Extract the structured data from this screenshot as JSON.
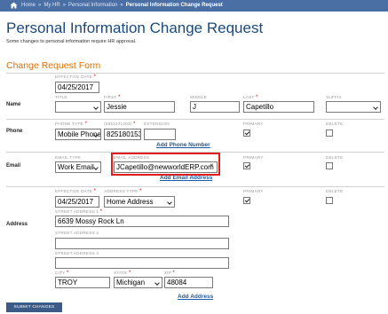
{
  "breadcrumb": {
    "items": [
      "Home",
      "My HR",
      "Personal Information"
    ],
    "separator": "»",
    "current": "Personal Information Change Request"
  },
  "page": {
    "title": "Personal Information Change Request",
    "subtitle": "Some changes to personal information require HR approval.",
    "section_title": "Change Request Form"
  },
  "name": {
    "row_label": "Name",
    "effective_date_label": "EFFECTIVE DATE",
    "effective_date": "04/25/2017",
    "title_label": "TITLE",
    "title_value": "",
    "first_label": "FIRST",
    "first_value": "Jessie",
    "middle_label": "MIDDLE",
    "middle_value": "J",
    "last_label": "LAST",
    "last_value": "Capetillo",
    "suffix_label": "SUFFIX",
    "suffix_value": ""
  },
  "phone": {
    "row_label": "Phone",
    "type_label": "PHONE TYPE",
    "type_value": "Mobile Phone",
    "number_label": "(5551231203)",
    "number_value": "8251801539",
    "extension_label": "EXTENSION",
    "extension_value": "",
    "primary_label": "PRIMARY",
    "primary_checked": true,
    "delete_label": "DELETE",
    "delete_checked": false,
    "add_link": "Add Phone Number"
  },
  "email": {
    "row_label": "Email",
    "type_label": "EMAIL TYPE",
    "type_value": "Work Email",
    "address_label": "EMAIL ADDRESS",
    "address_value": "JCapetillo@newworldERP.com",
    "clear_glyph": "×",
    "primary_label": "PRIMARY",
    "primary_checked": true,
    "delete_label": "DELETE",
    "delete_checked": false,
    "add_link": "Add Email Address"
  },
  "address": {
    "row_label": "Address",
    "effective_date_label": "EFFECTIVE DATE",
    "effective_date": "04/25/2017",
    "type_label": "ADDRESS TYPE",
    "type_value": "Home Address",
    "primary_label": "PRIMARY",
    "primary_checked": true,
    "delete_label": "DELETE",
    "delete_checked": false,
    "street1_label": "STREET ADDRESS 1",
    "street1_value": "6639 Mossy Rock Ln",
    "street2_label": "STREET ADDRESS 2",
    "street2_value": "",
    "street3_label": "STREET ADDRESS 3",
    "street3_value": "",
    "city_label": "CITY",
    "city_value": "TROY",
    "state_label": "STATE",
    "state_value": "Michigan",
    "zip_label": "ZIP",
    "zip_value": "48084",
    "add_link": "Add Address"
  },
  "actions": {
    "submit_label": "SUBMIT CHANGES"
  },
  "icons": {
    "home": "home-icon"
  },
  "colors": {
    "header_bar": "#4a6fa5",
    "title": "#1a4a7e",
    "section": "#e07000",
    "required": "#e00000",
    "highlight": "#e01c1c"
  }
}
